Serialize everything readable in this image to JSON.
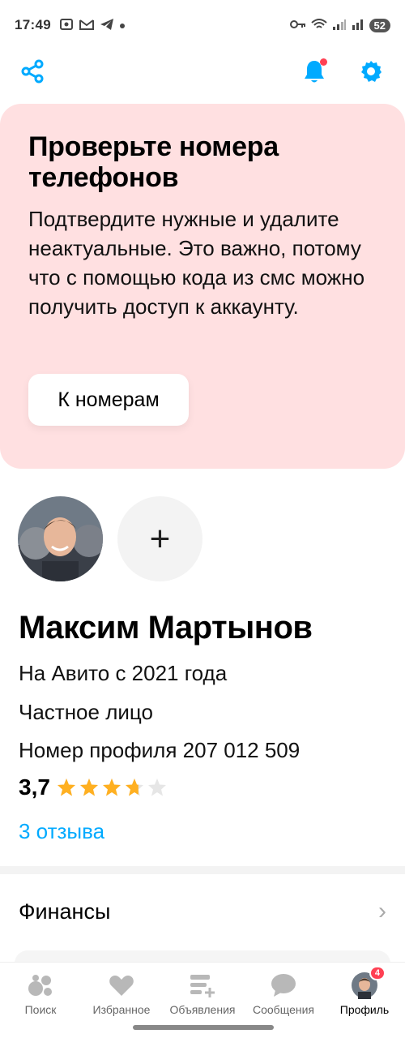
{
  "status": {
    "time": "17:49",
    "battery": "52"
  },
  "banner": {
    "title": "Проверьте номера телефонов",
    "text": "Подтвердите нужные и удалите неактуальные. Это важно, потому что с помощью кода из смс можно получить доступ к аккаунту.",
    "button": "К номерам",
    "bg": "#ffe0e1"
  },
  "profile": {
    "add_symbol": "+",
    "name": "Максим Мартынов",
    "since": "На Авито с 2021 года",
    "type": "Частное лицо",
    "profile_number": "Номер профиля 207 012 509",
    "rating": "3,7",
    "rating_value": 3.7,
    "rating_max": 5,
    "reviews": "3 отзыва"
  },
  "finance": {
    "label": "Финансы",
    "chevron": "›"
  },
  "nav": {
    "tabs": [
      {
        "label": "Поиск",
        "icon": "search-circles-icon"
      },
      {
        "label": "Избранное",
        "icon": "heart-icon"
      },
      {
        "label": "Объявления",
        "icon": "listing-icon"
      },
      {
        "label": "Сообщения",
        "icon": "chat-bubble-icon"
      },
      {
        "label": "Профиль",
        "icon": "avatar-icon",
        "badge": "4"
      }
    ]
  },
  "colors": {
    "accent": "#00aaff",
    "star": "#ffb021",
    "star_empty": "#e6e6e6",
    "notification": "#ff4053"
  }
}
